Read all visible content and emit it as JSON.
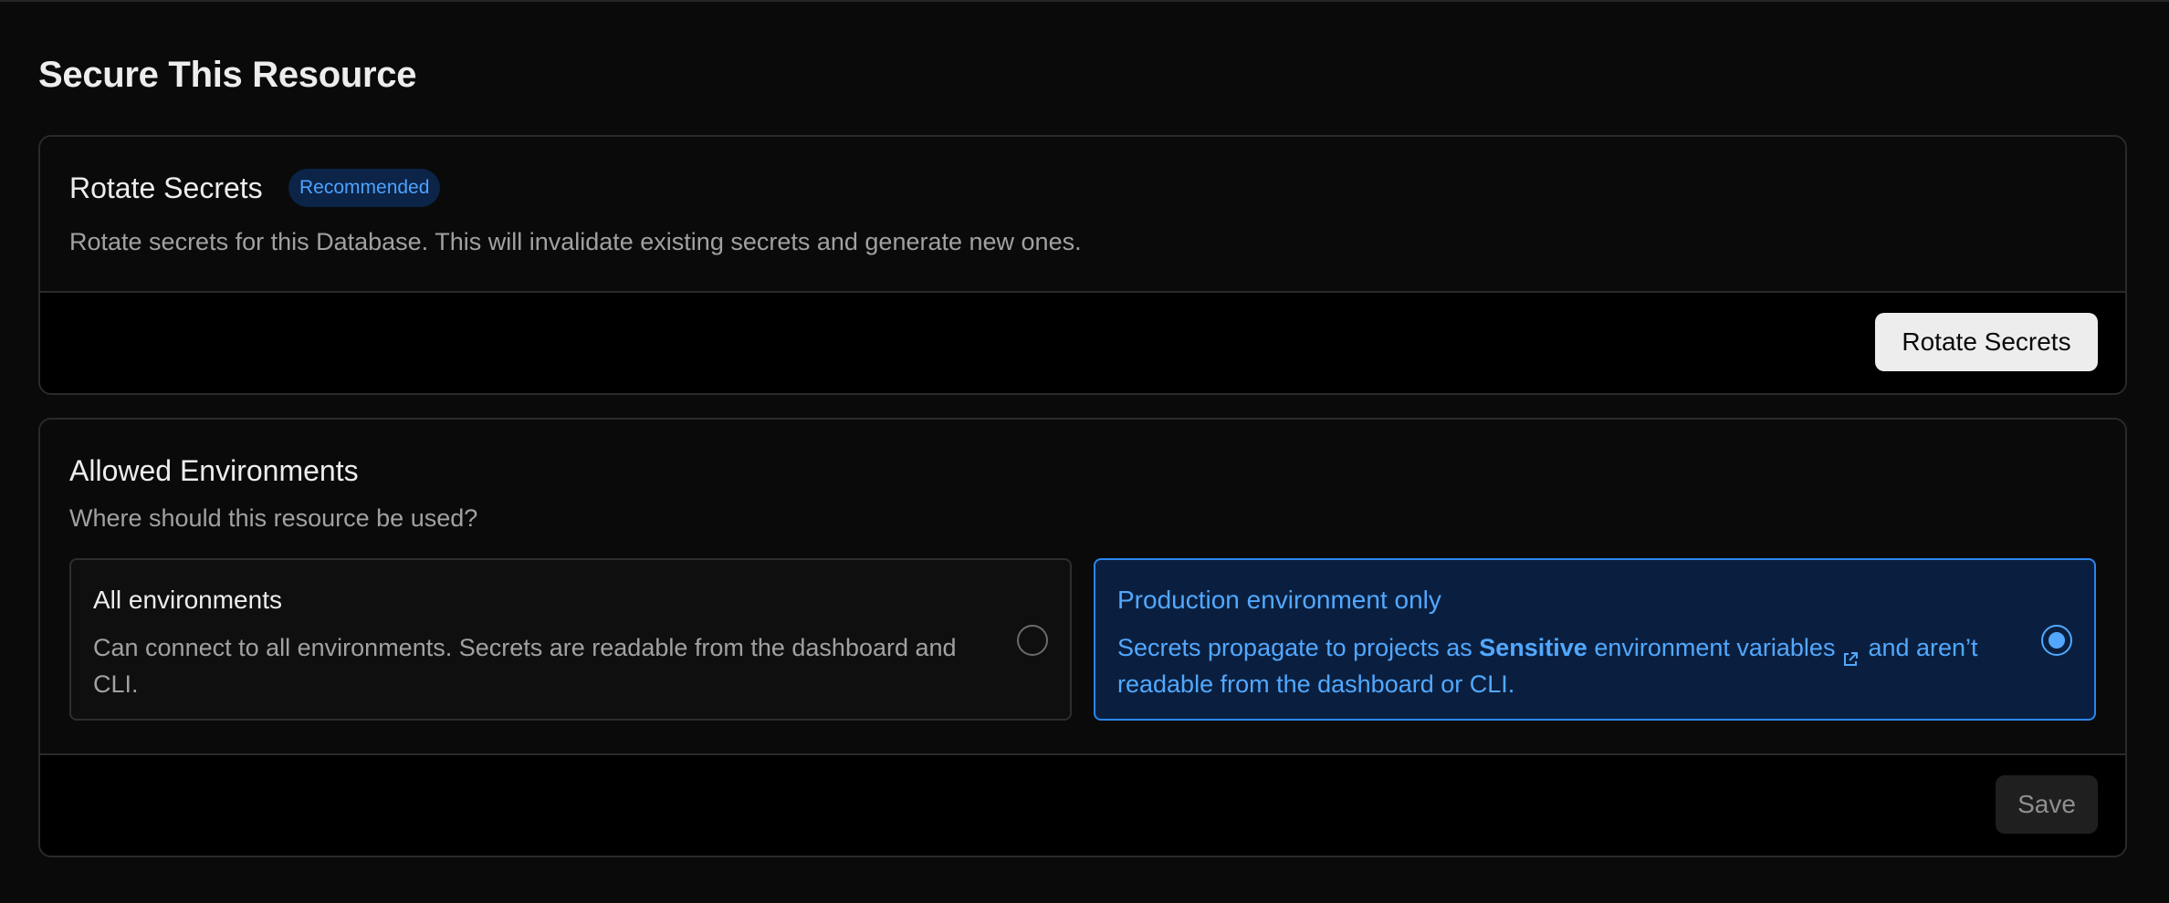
{
  "page": {
    "title": "Secure This Resource"
  },
  "rotate": {
    "title": "Rotate Secrets",
    "badge": "Recommended",
    "description": "Rotate secrets for this Database. This will invalidate existing secrets and generate new ones.",
    "button_label": "Rotate Secrets"
  },
  "environments": {
    "title": "Allowed Environments",
    "description": "Where should this resource be used?",
    "options": [
      {
        "title": "All environments",
        "text": "Can connect to all environments. Secrets are readable from the dashboard and CLI.",
        "selected": false
      },
      {
        "title": "Production environment only",
        "text_before": "Secrets propagate to projects as",
        "text_strong": "Sensitive",
        "text_link": "environment variables",
        "text_after": "and aren’t readable from the dashboard or CLI.",
        "selected": true
      }
    ],
    "save_label": "Save"
  },
  "colors": {
    "accent": "#52a8ff",
    "badge_bg": "#0b2447",
    "selected_bg": "#0a1f3f",
    "background": "#0a0a0a"
  },
  "icons": [
    "external-link-icon",
    "radio-selected-icon",
    "radio-empty-icon"
  ]
}
